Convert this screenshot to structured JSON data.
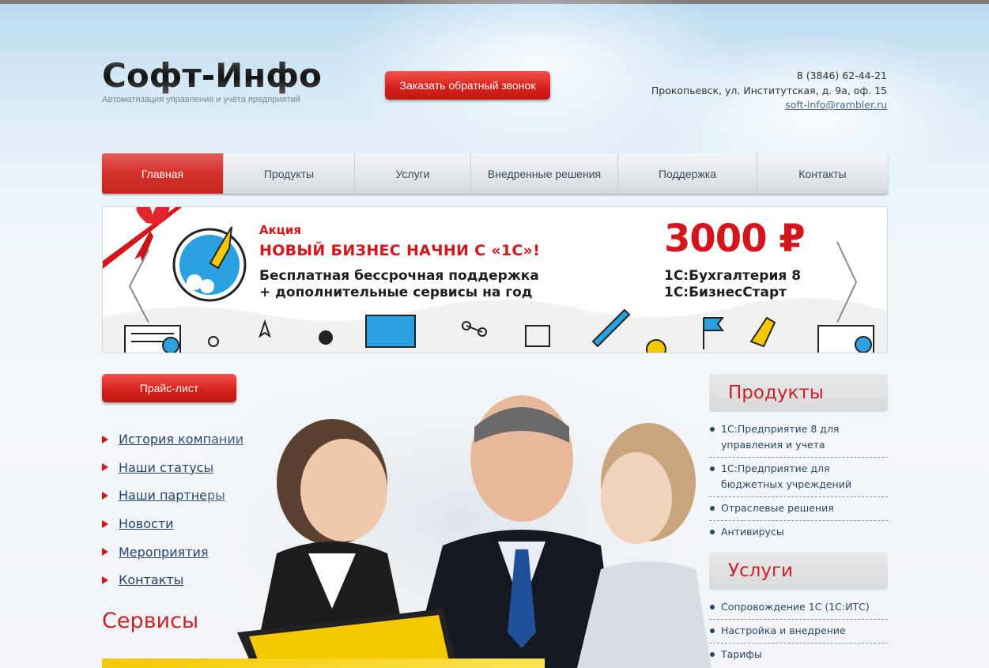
{
  "header": {
    "logo_title": "Софт-Инфо",
    "logo_subtitle": "Автоматизация управления и учёта предприятий",
    "callback_button": "Заказать обратный звонок",
    "phone": "8 (3846) 62-44-21",
    "address": "Прокопьевск, ул. Институтская, д. 9а, оф. 15",
    "email": "soft-info@rambler.ru"
  },
  "nav": {
    "items": [
      "Главная",
      "Продукты",
      "Услуги",
      "Внедренные решения",
      "Поддержка",
      "Контакты"
    ],
    "active": "Главная"
  },
  "banner": {
    "label": "Акция",
    "headline": "НОВЫЙ БИЗНЕС НАЧНИ С «1С»!",
    "line1": "Бесплатная бессрочная поддержка",
    "line2": "+ дополнительные сервисы на год",
    "price": "3000 ₽",
    "product1": "1С:Бухгалтерия 8",
    "product2": "1С:БизнесСтарт"
  },
  "price_button": "Прайс-лист",
  "left_menu": [
    "История компании",
    "Наши статусы",
    "Наши партнеры",
    "Новости",
    "Мероприятия",
    "Контакты"
  ],
  "services_title": "Сервисы",
  "sidebar": {
    "products": {
      "title": "Продукты",
      "items": [
        "1С:Предприятие 8 для управления и учета",
        "1С:Предприятие для бюджетных учреждений",
        "Отраслевые решения",
        "Антивирусы"
      ]
    },
    "services": {
      "title": "Услуги",
      "items": [
        "Сопровождение 1С (1С:ИТС)",
        "Настройка и внедрение",
        "Тарифы"
      ]
    }
  },
  "colors": {
    "accent_red": "#d4151c",
    "link_blue": "#25456a",
    "nav_bg": "#e3e6ea"
  }
}
